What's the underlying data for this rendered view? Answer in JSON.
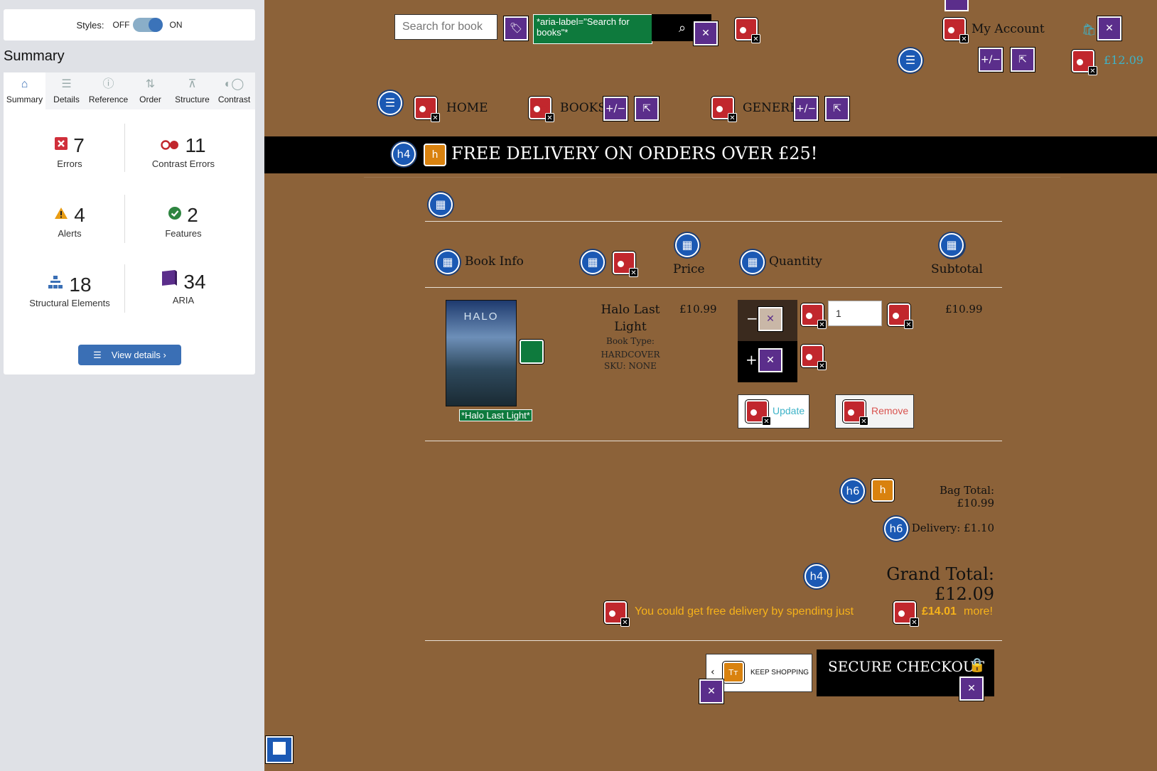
{
  "panel": {
    "styles_label": "Styles:",
    "off": "OFF",
    "on": "ON",
    "summary_title": "Summary",
    "tabs": [
      {
        "label": "Summary",
        "icon": "home-icon"
      },
      {
        "label": "Details",
        "icon": "list-icon"
      },
      {
        "label": "Reference",
        "icon": "info-icon"
      },
      {
        "label": "Order",
        "icon": "order-icon"
      },
      {
        "label": "Structure",
        "icon": "hierarchy-icon"
      },
      {
        "label": "Contrast",
        "icon": "contrast-icon"
      }
    ],
    "stats": {
      "errors": {
        "num": "7",
        "label": "Errors",
        "color": "#d02f3a"
      },
      "contrast": {
        "num": "11",
        "label": "Contrast Errors",
        "color": "#c1272d"
      },
      "alerts": {
        "num": "4",
        "label": "Alerts",
        "color": "#e89c13"
      },
      "features": {
        "num": "2",
        "label": "Features",
        "color": "#2e8540"
      },
      "structure": {
        "num": "18",
        "label": "Structural Elements",
        "color": "#3a6fb5"
      },
      "aria": {
        "num": "34",
        "label": "ARIA",
        "color": "#5b2e8b"
      }
    },
    "view_details": "View details ›"
  },
  "site": {
    "search_placeholder": "Search for book",
    "aria_label_note": "*aria-label=\"Search for books\"*",
    "my_account": "My Account",
    "bag_total": "£12.09",
    "nav": {
      "home": "HOME",
      "books": "BOOKS",
      "genere": "GENERE"
    },
    "banner": "FREE DELIVERY ON ORDERS OVER £25!",
    "table": {
      "headers": {
        "book_info": "Book Info",
        "price": "Price",
        "quantity": "Quantity",
        "subtotal": "Subtotal"
      },
      "row": {
        "title": "Halo Last Light",
        "type": "Book Type: HARDCOVER",
        "sku": "SKU: NONE",
        "price": "£10.99",
        "quantity": "1",
        "subtotal": "£10.99",
        "alt": "*Halo Last Light*",
        "minus": "−",
        "plus": "+"
      },
      "update": "Update",
      "remove": "Remove"
    },
    "totals": {
      "bag": "Bag Total: £10.99",
      "delivery": "Delivery: £1.10",
      "grand": "Grand Total: £12.09",
      "free_msg": "You could get free delivery by spending just",
      "free_amount": "£14.01",
      "free_more": "more!"
    },
    "keep_shopping": "KEEP SHOPPING",
    "secure_checkout": "SECURE CHECKOUT",
    "colors": {
      "site_bg": "#8c6239",
      "banner_bg": "#000000",
      "accent_link": "#3eb3c8",
      "warning_text": "#f6b21a",
      "error_red": "#c1272d",
      "aria_purple": "#5b2e8b",
      "structure_blue": "#1b59b4"
    }
  }
}
